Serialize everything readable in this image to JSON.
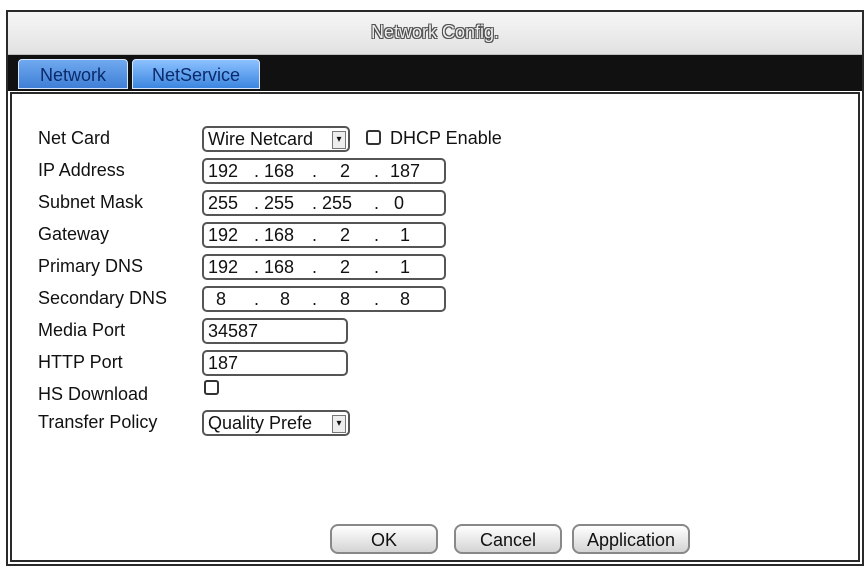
{
  "window": {
    "title": "Network Config."
  },
  "tabs": [
    {
      "label": "Network"
    },
    {
      "label": "NetService"
    }
  ],
  "form": {
    "net_card": {
      "label": "Net Card",
      "value": "Wire Netcard"
    },
    "dhcp": {
      "label": "DHCP Enable",
      "checked": false
    },
    "ip_address": {
      "label": "IP Address",
      "octets": [
        "192",
        "168",
        "2",
        "187"
      ]
    },
    "subnet_mask": {
      "label": "Subnet Mask",
      "octets": [
        "255",
        "255",
        "255",
        "0"
      ]
    },
    "gateway": {
      "label": "Gateway",
      "octets": [
        "192",
        "168",
        "2",
        "1"
      ]
    },
    "primary_dns": {
      "label": "Primary DNS",
      "octets": [
        "192",
        "168",
        "2",
        "1"
      ]
    },
    "secondary_dns": {
      "label": "Secondary DNS",
      "octets": [
        "8",
        "8",
        "8",
        "8"
      ]
    },
    "media_port": {
      "label": "Media Port",
      "value": "34587"
    },
    "http_port": {
      "label": "HTTP Port",
      "value": "187"
    },
    "hs_download": {
      "label": "HS Download",
      "checked": false
    },
    "transfer_policy": {
      "label": "Transfer Policy",
      "value": "Quality Prefe"
    }
  },
  "buttons": {
    "ok": "OK",
    "cancel": "Cancel",
    "application": "Application"
  },
  "icons": {
    "dropdown": "chevron-down-icon",
    "checkbox": "checkbox-icon"
  },
  "colors": {
    "tab_active": "#3c86e0",
    "tab_inactive": "#3f7fd6",
    "tabbar": "#111111"
  }
}
